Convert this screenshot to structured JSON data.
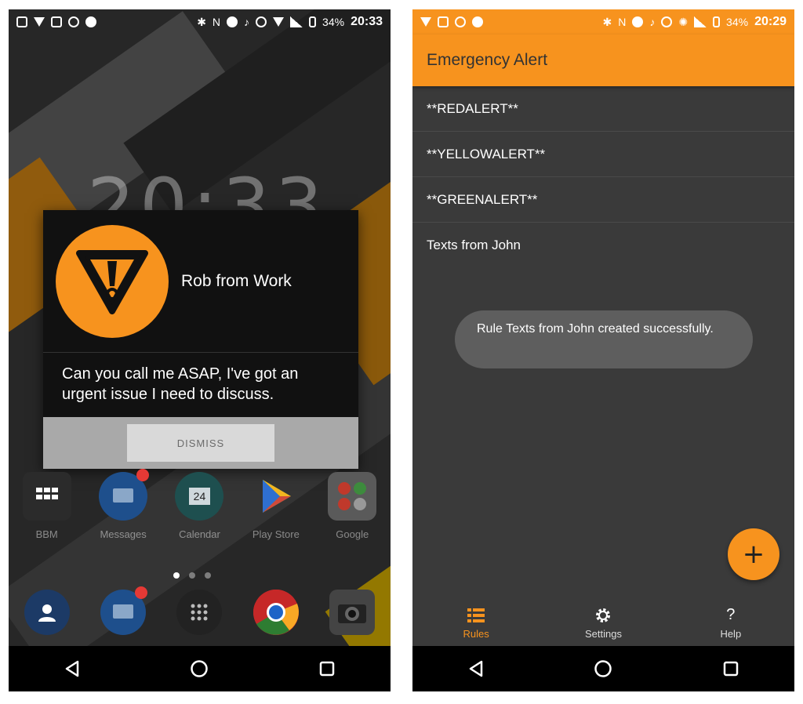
{
  "left_screen": {
    "status": {
      "battery": "34%",
      "time": "20:33"
    },
    "lock_clock": "20:33",
    "dialog": {
      "sender": "Rob from Work",
      "message": "Can you call me ASAP, I've got an urgent issue I need to discuss.",
      "dismiss_label": "DISMISS"
    },
    "apps": [
      {
        "label": "BBM",
        "icon": "bbm-icon",
        "badge": false
      },
      {
        "label": "Messages",
        "icon": "messages-icon",
        "badge": true
      },
      {
        "label": "Calendar",
        "icon": "calendar-icon",
        "badge": false,
        "day": "24"
      },
      {
        "label": "Play Store",
        "icon": "play-store-icon",
        "badge": false
      },
      {
        "label": "Google",
        "icon": "google-folder-icon",
        "badge": false
      }
    ]
  },
  "right_screen": {
    "status": {
      "battery": "34%",
      "time": "20:29"
    },
    "app_title": "Emergency Alert",
    "rules": [
      "**REDALERT**",
      "**YELLOWALERT**",
      "**GREENALERT**",
      "Texts from John"
    ],
    "toast": "Rule Texts from John created successfully.",
    "fab_label": "+",
    "bottom_nav": [
      {
        "label": "Rules",
        "icon": "rules-icon",
        "active": true
      },
      {
        "label": "Settings",
        "icon": "gear-icon",
        "active": false
      },
      {
        "label": "Help",
        "icon": "help-icon",
        "active": false,
        "glyph": "?"
      }
    ]
  },
  "colors": {
    "accent": "#f7931e",
    "dark_bg": "#3a3a3a",
    "dialog_bg": "#111111"
  }
}
